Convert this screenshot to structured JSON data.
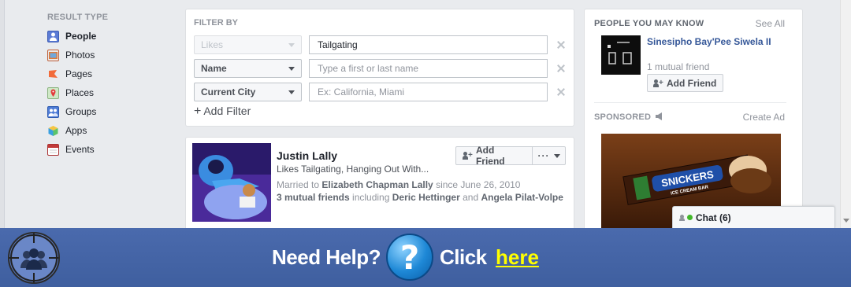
{
  "nav": {
    "title": "RESULT TYPE",
    "items": [
      {
        "label": "People",
        "active": true,
        "icon": "people-icon",
        "color": "#5b7bd5"
      },
      {
        "label": "Photos",
        "icon": "photos-icon",
        "color": "#e07b39"
      },
      {
        "label": "Pages",
        "icon": "pages-flag-icon",
        "color": "#f26b3a"
      },
      {
        "label": "Places",
        "icon": "places-pin-icon",
        "color": "#5fae4f"
      },
      {
        "label": "Groups",
        "icon": "groups-icon",
        "color": "#4d7bd6"
      },
      {
        "label": "Apps",
        "icon": "apps-cube-icon",
        "color": "#3aa0e0"
      },
      {
        "label": "Events",
        "icon": "events-calendar-icon",
        "color": "#c23a3a"
      }
    ]
  },
  "filter": {
    "title": "FILTER BY",
    "rows": [
      {
        "select": "Likes",
        "disabled": true,
        "value": "Tailgating",
        "placeholder": ""
      },
      {
        "select": "Name",
        "disabled": false,
        "value": "",
        "placeholder": "Type a first or last name"
      },
      {
        "select": "Current City",
        "disabled": false,
        "value": "",
        "placeholder": "Ex: California, Miami"
      }
    ],
    "add_filter": "Add Filter"
  },
  "result": {
    "name": "Justin Lally",
    "likes": "Likes Tailgating, Hanging Out With...",
    "married_prefix": "Married to ",
    "spouse": "Elizabeth Chapman Lally",
    "married_suffix": " since June 26, 2010",
    "mutual_count": "3 mutual friends",
    "mutual_mid": " including ",
    "mutual_a": "Deric Hettinger",
    "mutual_and": " and ",
    "mutual_b": "Angela Pilat-Volpe",
    "add_friend": "Add Friend",
    "more": "···"
  },
  "right": {
    "pymk_title": "PEOPLE YOU MAY KNOW",
    "see_all": "See All",
    "pymk_name": "Sinesipho Bay'Pee Siwela II",
    "pymk_mutual": "1 mutual friend",
    "pymk_add": "Add Friend",
    "sponsored": "SPONSORED",
    "create_ad": "Create Ad",
    "ad_brand": "SNICKERS",
    "ad_sub": "ICE CREAM BAR"
  },
  "chat": {
    "label": "Chat (6)"
  },
  "banner": {
    "need_help": "Need Help?",
    "question_mark": "?",
    "click": "Click",
    "here": "here"
  }
}
